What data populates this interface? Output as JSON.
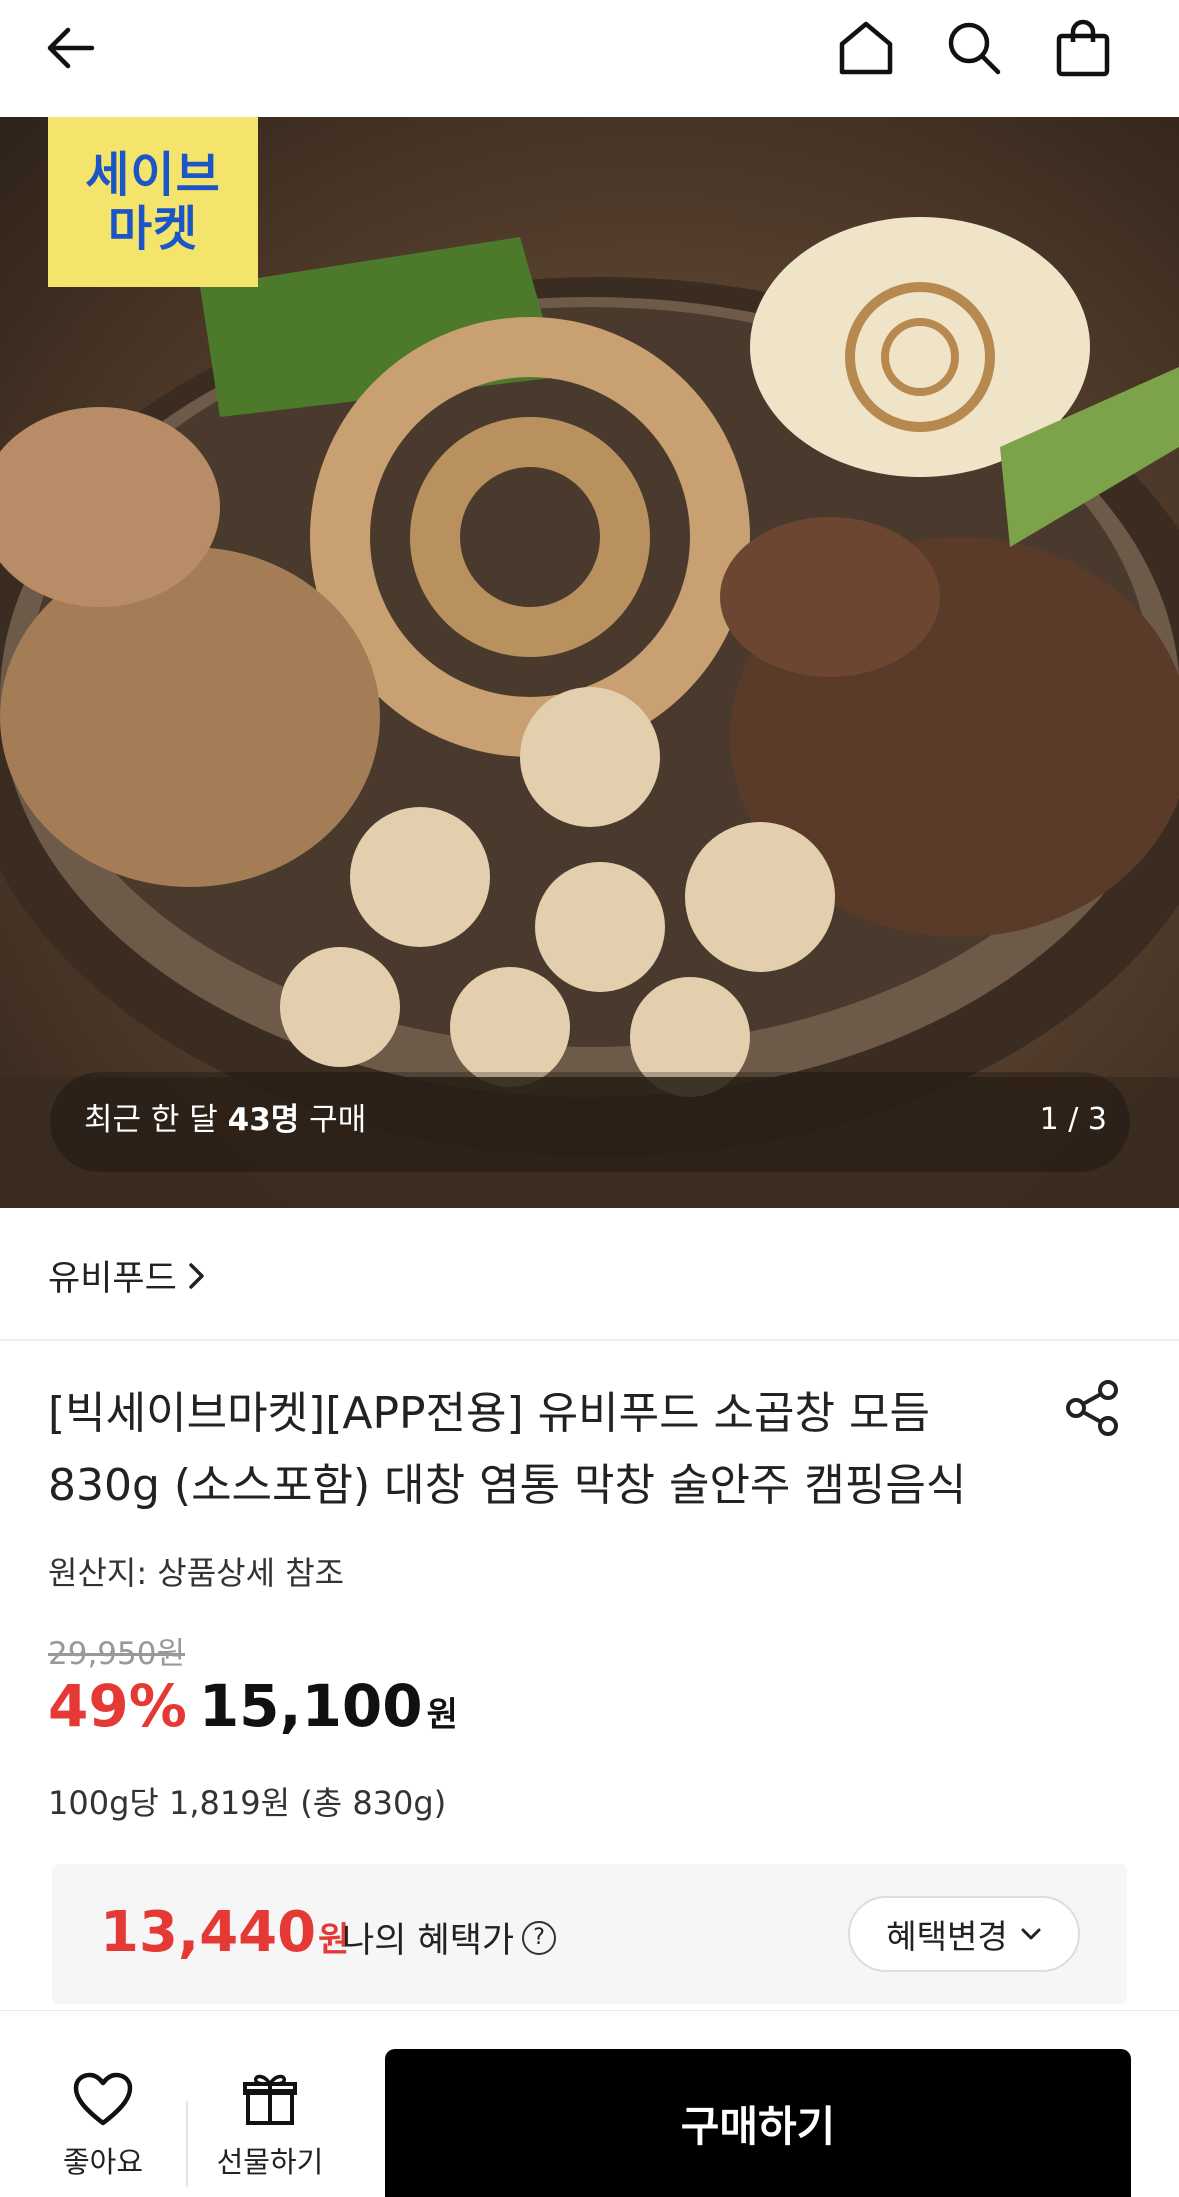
{
  "header": {
    "back_icon": "arrow-left-icon",
    "home_icon": "home-icon",
    "search_icon": "search-icon",
    "bag_icon": "shopping-bag-icon"
  },
  "hero": {
    "badge_line1": "세이브",
    "badge_line2": "마켓",
    "recent_prefix": "최근 한 달 ",
    "recent_count": "43명",
    "recent_suffix": " 구매",
    "pager": "1 / 3"
  },
  "brand": {
    "name": "유비푸드",
    "chevron": "›"
  },
  "product": {
    "title": "[빅세이브마켓][APP전용] 유비푸드 소곱창 모듬 830g (소스포함) 대창 염통 막창 술안주 캠핑음식",
    "origin": "원산지: 상품상세 참조",
    "original_price": "29,950원",
    "discount": "49%",
    "sale_price": "15,100",
    "won": "원",
    "unit_price": "100g당 1,819원 (총 830g)"
  },
  "benefit": {
    "price": "13,440",
    "won": "원",
    "label": "나의 혜택가",
    "help": "?",
    "change_label": "혜택변경"
  },
  "bottom_bar": {
    "like_label": "좋아요",
    "gift_label": "선물하기",
    "buy_label": "구매하기"
  },
  "colors": {
    "accent_red": "#e53935",
    "badge_yellow": "#f5e46b",
    "badge_blue": "#1b55c8",
    "buy_black": "#000000"
  }
}
